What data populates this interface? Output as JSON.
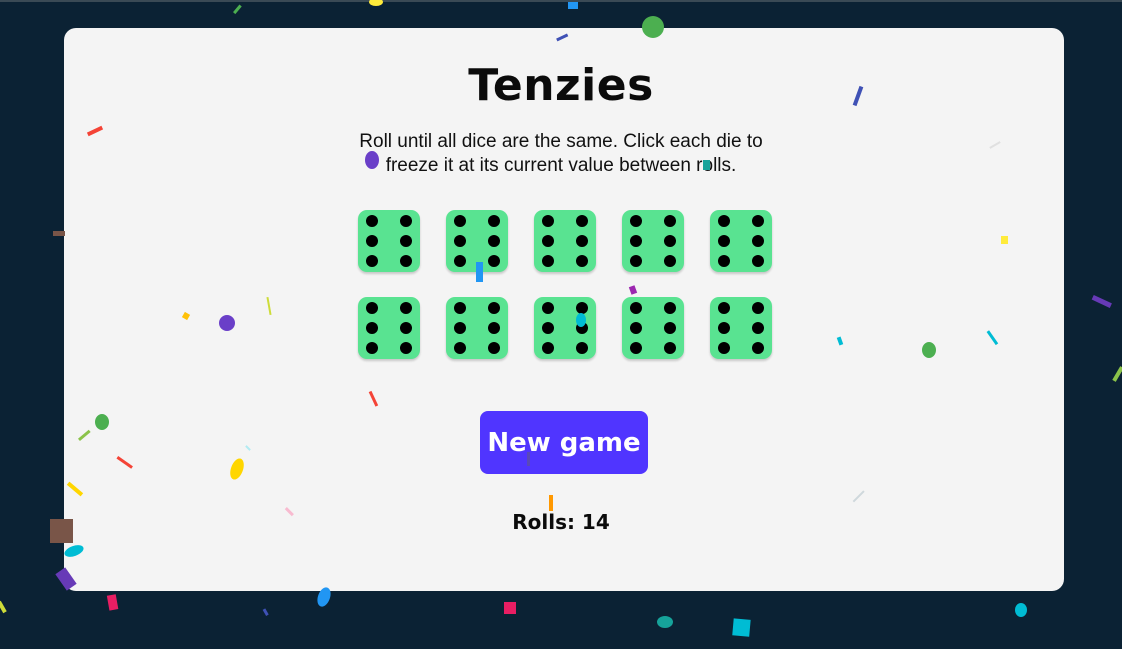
{
  "game": {
    "title": "Tenzies",
    "instructions_line1": "Roll until all dice are the same. Click each die to",
    "instructions_line2": "freeze it at its current value between rolls.",
    "new_game_label": "New game",
    "rolls_text": "Rolls: 14"
  },
  "dice": [
    {
      "value": 6,
      "held": true
    },
    {
      "value": 6,
      "held": true
    },
    {
      "value": 6,
      "held": true
    },
    {
      "value": 6,
      "held": true
    },
    {
      "value": 6,
      "held": true
    },
    {
      "value": 6,
      "held": true
    },
    {
      "value": 6,
      "held": true
    },
    {
      "value": 6,
      "held": true
    },
    {
      "value": 6,
      "held": true
    },
    {
      "value": 6,
      "held": true
    }
  ],
  "colors": {
    "background": "#0b2234",
    "card": "#f4f4f4",
    "die_held": "#59e391",
    "pip": "#000000",
    "button": "#5035ff"
  }
}
